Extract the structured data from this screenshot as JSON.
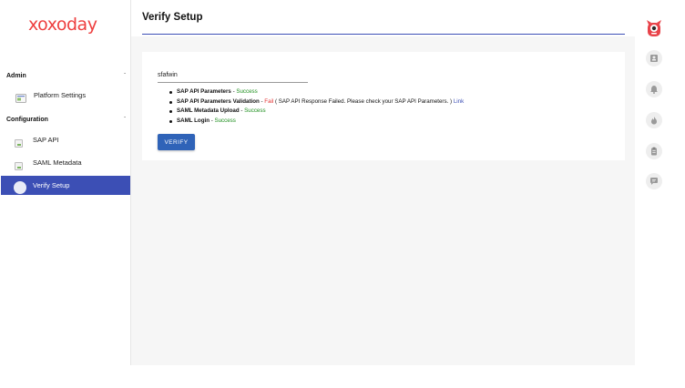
{
  "brand": {
    "logo_text": "xoxoday",
    "accent": "#ee3f3f",
    "primary": "#3c4fb5"
  },
  "sidebar": {
    "sections": [
      {
        "label": "Admin",
        "chevron": "chevron-down-icon",
        "items": [
          {
            "label": "Platform Settings",
            "icon": "settings-card-icon"
          }
        ]
      },
      {
        "label": "Configuration",
        "chevron": "chevron-down-icon",
        "items": [
          {
            "label": "SAP API",
            "icon": "broken-image-icon"
          },
          {
            "label": "SAML Metadata",
            "icon": "broken-image-icon"
          },
          {
            "label": "Verify Setup",
            "icon": "broken-image-icon",
            "active": true
          }
        ]
      }
    ]
  },
  "main": {
    "title": "Verify Setup",
    "app_name": "sfafwin",
    "results": [
      {
        "label": "SAP API Parameters",
        "sep": " - ",
        "status": "Success"
      },
      {
        "label": "SAP API Parameters Validation",
        "sep": " - ",
        "status": "Fail",
        "message": " ( SAP API Response Failed. Please check your SAP API Parameters. ) ",
        "link": "Link"
      },
      {
        "label": "SAML Metadata Upload",
        "sep": " - ",
        "status": "Success"
      },
      {
        "label": "SAML Login",
        "sep": " - ",
        "status": "Success"
      }
    ],
    "verify_button": "VERIFY"
  },
  "rail": {
    "icons": [
      "monster-avatar-icon",
      "contact-card-icon",
      "bell-icon",
      "fire-icon",
      "clipboard-icon",
      "chat-icon"
    ]
  }
}
